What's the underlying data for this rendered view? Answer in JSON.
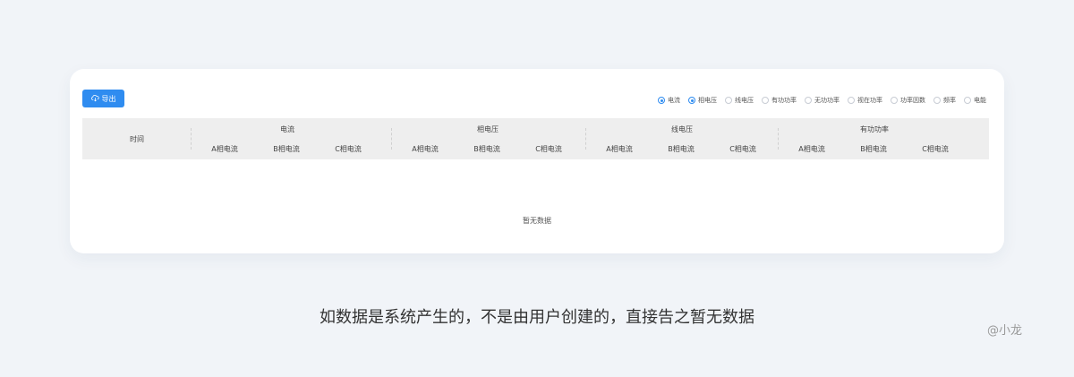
{
  "toolbar": {
    "export_label": "导出"
  },
  "radio_options": [
    {
      "label": "电流",
      "checked": true
    },
    {
      "label": "相电压",
      "checked": true
    },
    {
      "label": "线电压",
      "checked": false
    },
    {
      "label": "有功功率",
      "checked": false
    },
    {
      "label": "无功功率",
      "checked": false
    },
    {
      "label": "视在功率",
      "checked": false
    },
    {
      "label": "功率因数",
      "checked": false
    },
    {
      "label": "频率",
      "checked": false
    },
    {
      "label": "电能",
      "checked": false
    }
  ],
  "table": {
    "time_header": "时间",
    "groups": [
      {
        "title": "电流",
        "columns": [
          "A相电流",
          "B相电流",
          "C相电流"
        ]
      },
      {
        "title": "相电压",
        "columns": [
          "A相电流",
          "B相电流",
          "C相电流"
        ]
      },
      {
        "title": "线电压",
        "columns": [
          "A相电流",
          "B相电流",
          "C相电流"
        ]
      },
      {
        "title": "有功功率",
        "columns": [
          "A相电流",
          "B相电流",
          "C相电流"
        ]
      }
    ],
    "empty_text": "暂无数据"
  },
  "caption": "如数据是系统产生的，不是由用户创建的，直接告之暂无数据",
  "author": "@小龙",
  "colors": {
    "accent": "#2f8cf0",
    "background": "#f1f4f8",
    "header_bg": "#eeeeee"
  }
}
